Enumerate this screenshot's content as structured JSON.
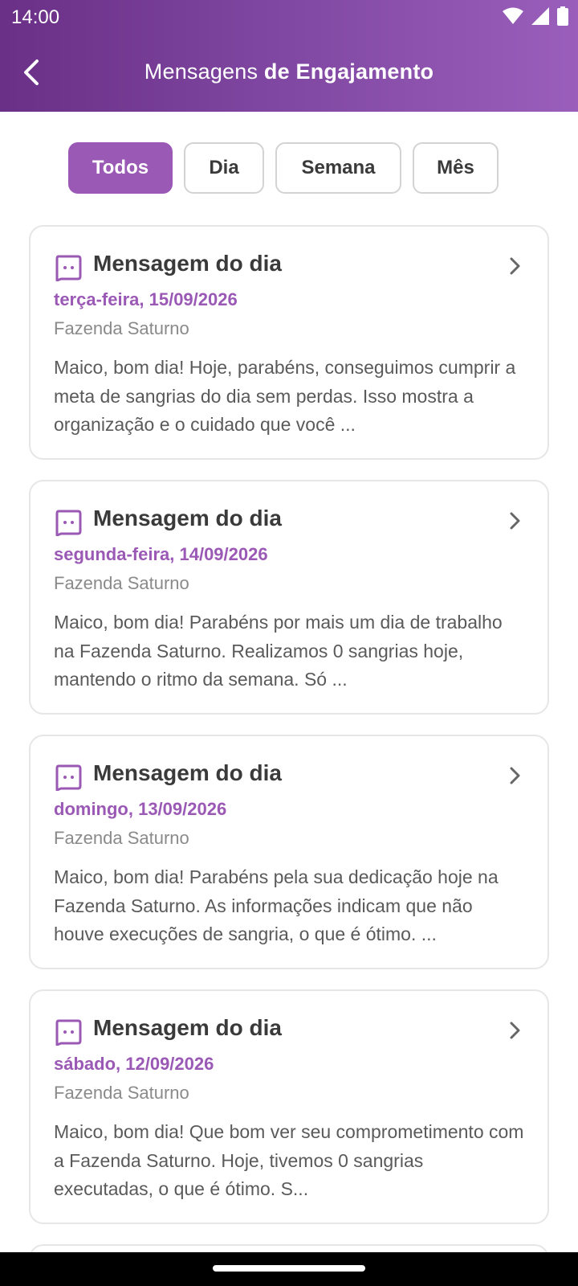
{
  "status_bar": {
    "time": "14:00"
  },
  "header": {
    "title_regular": "Mensagens",
    "title_bold": "de Engajamento"
  },
  "filters": [
    {
      "label": "Todos",
      "active": true
    },
    {
      "label": "Dia",
      "active": false
    },
    {
      "label": "Semana",
      "active": false
    },
    {
      "label": "Mês",
      "active": false
    }
  ],
  "cards": [
    {
      "title": "Mensagem do dia",
      "date": "terça-feira, 15/09/2026",
      "farm": "Fazenda Saturno",
      "preview": "Maico, bom dia! Hoje, parabéns, conseguimos cumprir a meta de sangrias do dia sem perdas. Isso mostra a organização e o cuidado que você ..."
    },
    {
      "title": "Mensagem do dia",
      "date": "segunda-feira, 14/09/2026",
      "farm": "Fazenda Saturno",
      "preview": "Maico, bom dia! Parabéns por mais um dia de trabalho na Fazenda Saturno. Realizamos 0 sangrias hoje, mantendo o ritmo da semana. Só ..."
    },
    {
      "title": "Mensagem do dia",
      "date": "domingo, 13/09/2026",
      "farm": "Fazenda Saturno",
      "preview": "Maico, bom dia! Parabéns pela sua dedicação hoje na Fazenda Saturno. As informações indicam que não houve execuções de sangria, o que é ótimo. ..."
    },
    {
      "title": "Mensagem do dia",
      "date": "sábado, 12/09/2026",
      "farm": "Fazenda Saturno",
      "preview": "Maico, bom dia! Que bom ver seu comprometimento com a Fazenda Saturno. Hoje, tivemos 0 sangrias executadas, o que é ótimo. S..."
    }
  ],
  "colors": {
    "accent": "#9b59b6",
    "header_start": "#6a2f86",
    "header_end": "#9a5ebb"
  },
  "icons": [
    "back-arrow-icon",
    "wifi-icon",
    "signal-icon",
    "battery-icon",
    "message-icon",
    "chevron-right-icon"
  ]
}
